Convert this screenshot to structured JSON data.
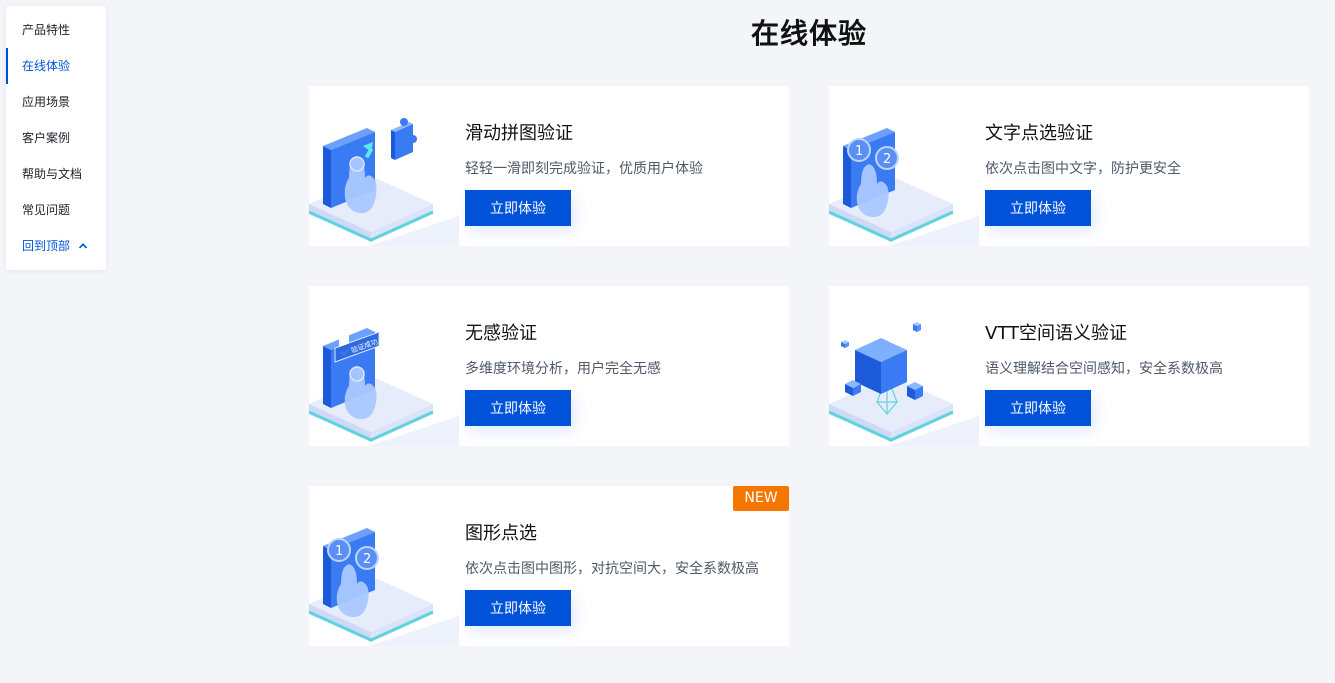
{
  "sidebar": {
    "items": [
      {
        "label": "产品特性"
      },
      {
        "label": "在线体验"
      },
      {
        "label": "应用场景"
      },
      {
        "label": "客户案例"
      },
      {
        "label": "帮助与文档"
      },
      {
        "label": "常见问题"
      }
    ],
    "back_to_top": "回到顶部"
  },
  "main": {
    "title": "在线体验",
    "cards": [
      {
        "title": "滑动拼图验证",
        "desc": "轻轻一滑即刻完成验证，优质用户体验",
        "button": "立即体验",
        "icon": "slider-puzzle-illustration"
      },
      {
        "title": "文字点选验证",
        "desc": "依次点击图中文字，防护更安全",
        "button": "立即体验",
        "icon": "text-click-illustration"
      },
      {
        "title": "无感验证",
        "desc": "多维度环境分析，用户完全无感",
        "button": "立即体验",
        "icon": "invisible-verify-illustration",
        "illus_caption": "验证成功"
      },
      {
        "title": "VTT空间语义验证",
        "desc": "语义理解结合空间感知，安全系数极高",
        "button": "立即体验",
        "icon": "spatial-cube-illustration"
      },
      {
        "title": "图形点选",
        "desc": "依次点击图中图形，对抗空间大，安全系数极高",
        "button": "立即体验",
        "icon": "shape-click-illustration",
        "badge": "NEW"
      }
    ]
  },
  "colors": {
    "accent": "#0052d9",
    "badge": "#f57700",
    "background": "#f3f5f9"
  }
}
